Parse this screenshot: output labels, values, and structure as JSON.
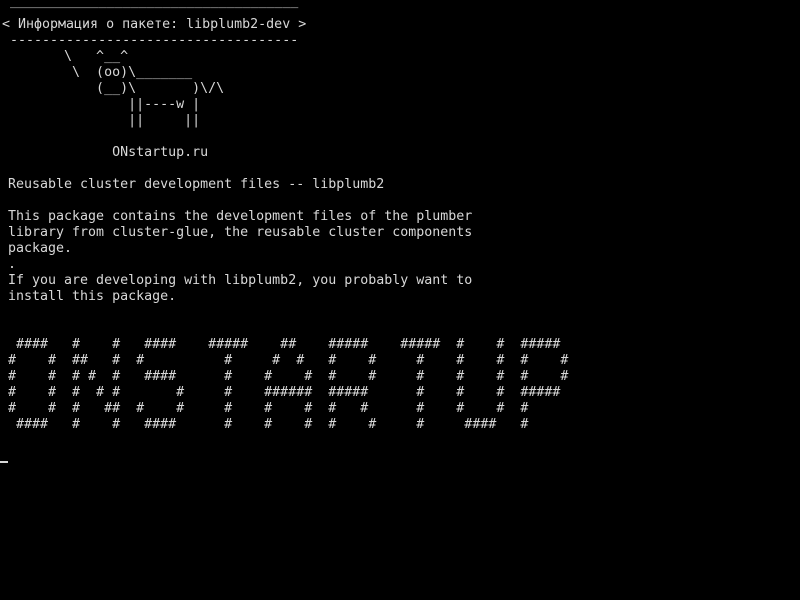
{
  "terminal": {
    "cowsay": {
      "top_border": " ____________________________________",
      "title": "< Информация о пакете: libplumb2-dev >",
      "bottom_border": " ------------------------------------",
      "cow": [
        "       \\   ^__^",
        "        \\  (oo)\\_______",
        "           (__)\\       )\\/\\",
        "               ||----w |",
        "               ||     ||"
      ],
      "site": "             ONstartup.ru"
    },
    "description": {
      "summary": "Reusable cluster development files -- libplumb2",
      "body": [
        "This package contains the development files of the plumber",
        "library from cluster-glue, the reusable cluster components",
        "package.",
        ".",
        "If you are developing with libplumb2, you probably want to",
        "install this package."
      ]
    },
    "banner": [
      " ####   #    #   ####    #####    ##    #####    #####  #    #  #####",
      "#    #  ##   #  #          #     #  #   #    #     #    #    #  #    #",
      "#    #  # #  #   ####      #    #    #  #    #     #    #    #  #    #",
      "#    #  #  # #       #     #    ######  #####      #    #    #  #####",
      "#    #  #   ##  #    #     #    #    #  #   #      #    #    #  #",
      " ####   #    #   ####      #    #    #  #    #     #     ####   #"
    ],
    "colors": {
      "background": "#000000",
      "foreground": "#d8d8d8"
    }
  }
}
